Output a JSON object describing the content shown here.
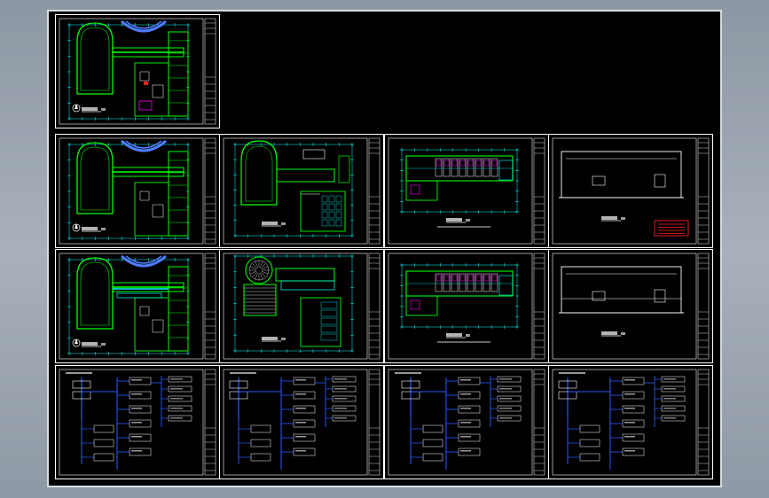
{
  "app": {
    "title": ""
  },
  "colors": {
    "viewport_bg": "#9aa4af",
    "sheet_bg": "#000000",
    "frame": "#ffffff",
    "wall": "#00ff00",
    "dim": "#00ffff",
    "arch": "#4f7dff",
    "accent": "#ff00ff",
    "electric": "#2a5cff",
    "warn": "#ff2020",
    "text": "#ffffff"
  },
  "sheets": [
    {
      "id": "plan-1",
      "type": "plan-round",
      "row": 0,
      "col": 0
    },
    {
      "id": "plan-2",
      "type": "plan-round",
      "row": 1,
      "col": 0
    },
    {
      "id": "plan-3",
      "type": "plan-round-2",
      "row": 1,
      "col": 1
    },
    {
      "id": "plan-4",
      "type": "plan-rect",
      "row": 1,
      "col": 2
    },
    {
      "id": "elev-1",
      "type": "elevation",
      "row": 1,
      "col": 3
    },
    {
      "id": "plan-5",
      "type": "plan-round",
      "row": 2,
      "col": 0
    },
    {
      "id": "plan-6",
      "type": "plan-stair",
      "row": 2,
      "col": 1
    },
    {
      "id": "plan-7",
      "type": "plan-rect",
      "row": 2,
      "col": 2
    },
    {
      "id": "elev-2",
      "type": "elevation",
      "row": 2,
      "col": 3
    },
    {
      "id": "schem-1",
      "type": "schematic",
      "row": 3,
      "col": 0
    },
    {
      "id": "schem-2",
      "type": "schematic",
      "row": 3,
      "col": 1
    },
    {
      "id": "schem-3",
      "type": "schematic",
      "row": 3,
      "col": 2
    },
    {
      "id": "schem-4",
      "type": "schematic",
      "row": 3,
      "col": 3
    }
  ]
}
